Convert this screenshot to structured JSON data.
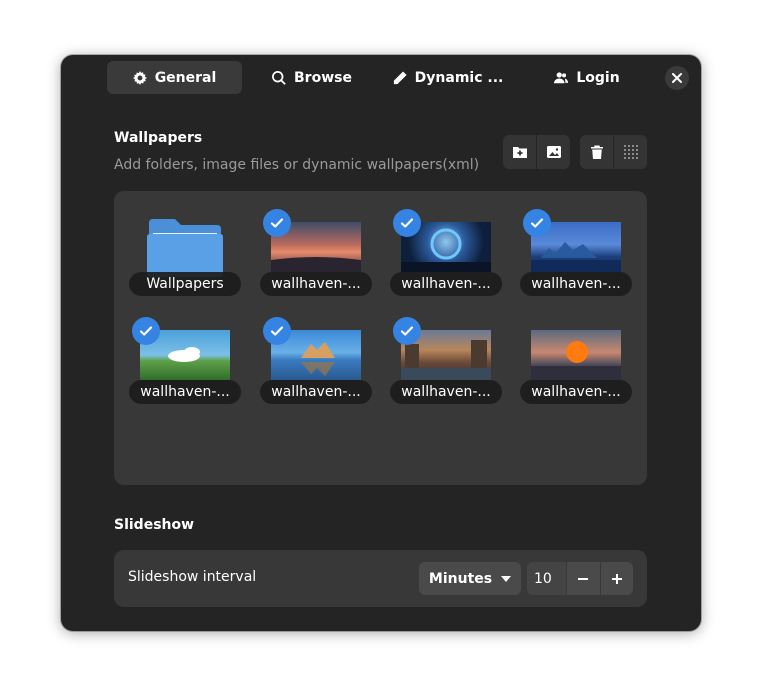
{
  "tabs": [
    {
      "label": "General",
      "icon": "gear-icon",
      "active": true
    },
    {
      "label": "Browse",
      "icon": "search-icon",
      "active": false
    },
    {
      "label": "Dynamic ...",
      "icon": "pencil-icon",
      "active": false
    },
    {
      "label": "Login",
      "icon": "users-icon",
      "active": false
    }
  ],
  "wallpapers": {
    "title": "Wallpapers",
    "subtitle": "Add folders, image files or dynamic wallpapers(xml)",
    "items": [
      {
        "label": "Wallpapers",
        "kind": "folder",
        "checked": false
      },
      {
        "label": "wallhaven-...",
        "kind": "image",
        "checked": true
      },
      {
        "label": "wallhaven-...",
        "kind": "image",
        "checked": true
      },
      {
        "label": "wallhaven-...",
        "kind": "image",
        "checked": true
      },
      {
        "label": "wallhaven-...",
        "kind": "image",
        "checked": true
      },
      {
        "label": "wallhaven-...",
        "kind": "image",
        "checked": true
      },
      {
        "label": "wallhaven-...",
        "kind": "image",
        "checked": true
      },
      {
        "label": "wallhaven-...",
        "kind": "image",
        "checked": false
      }
    ]
  },
  "slideshow": {
    "title": "Slideshow",
    "interval_label": "Slideshow interval",
    "unit": "Minutes",
    "value": "10"
  },
  "colors": {
    "window_bg": "#242424",
    "card_bg": "#383838",
    "accent": "#3584e4",
    "folder": "#5aa0e6"
  }
}
